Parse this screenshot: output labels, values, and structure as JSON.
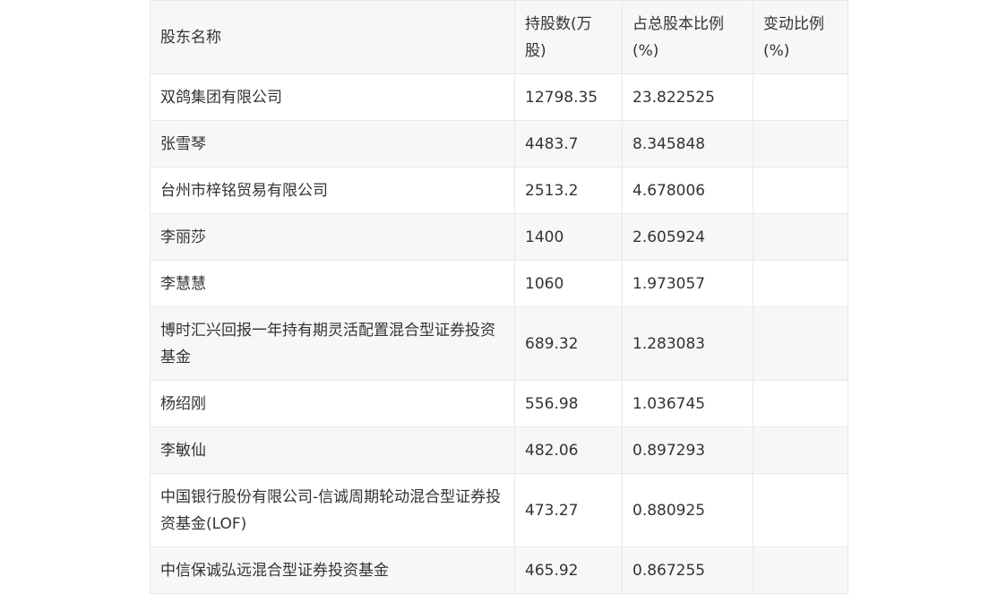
{
  "table": {
    "headers": [
      "股东名称",
      "持股数(万股)",
      "占总股本比例(%)",
      "变动比例(%)"
    ],
    "rows": [
      [
        "双鸽集团有限公司",
        "12798.35",
        "23.822525",
        ""
      ],
      [
        "张雪琴",
        "4483.7",
        "8.345848",
        ""
      ],
      [
        "台州市梓铭贸易有限公司",
        "2513.2",
        "4.678006",
        ""
      ],
      [
        "李丽莎",
        "1400",
        "2.605924",
        ""
      ],
      [
        "李慧慧",
        "1060",
        "1.973057",
        ""
      ],
      [
        "博时汇兴回报一年持有期灵活配置混合型证券投资基金",
        "689.32",
        "1.283083",
        ""
      ],
      [
        "杨绍刚",
        "556.98",
        "1.036745",
        ""
      ],
      [
        "李敏仙",
        "482.06",
        "0.897293",
        ""
      ],
      [
        "中国银行股份有限公司-信诚周期轮动混合型证券投资基金(LOF)",
        "473.27",
        "0.880925",
        ""
      ],
      [
        "中信保诚弘远混合型证券投资基金",
        "465.92",
        "0.867255",
        ""
      ]
    ]
  }
}
